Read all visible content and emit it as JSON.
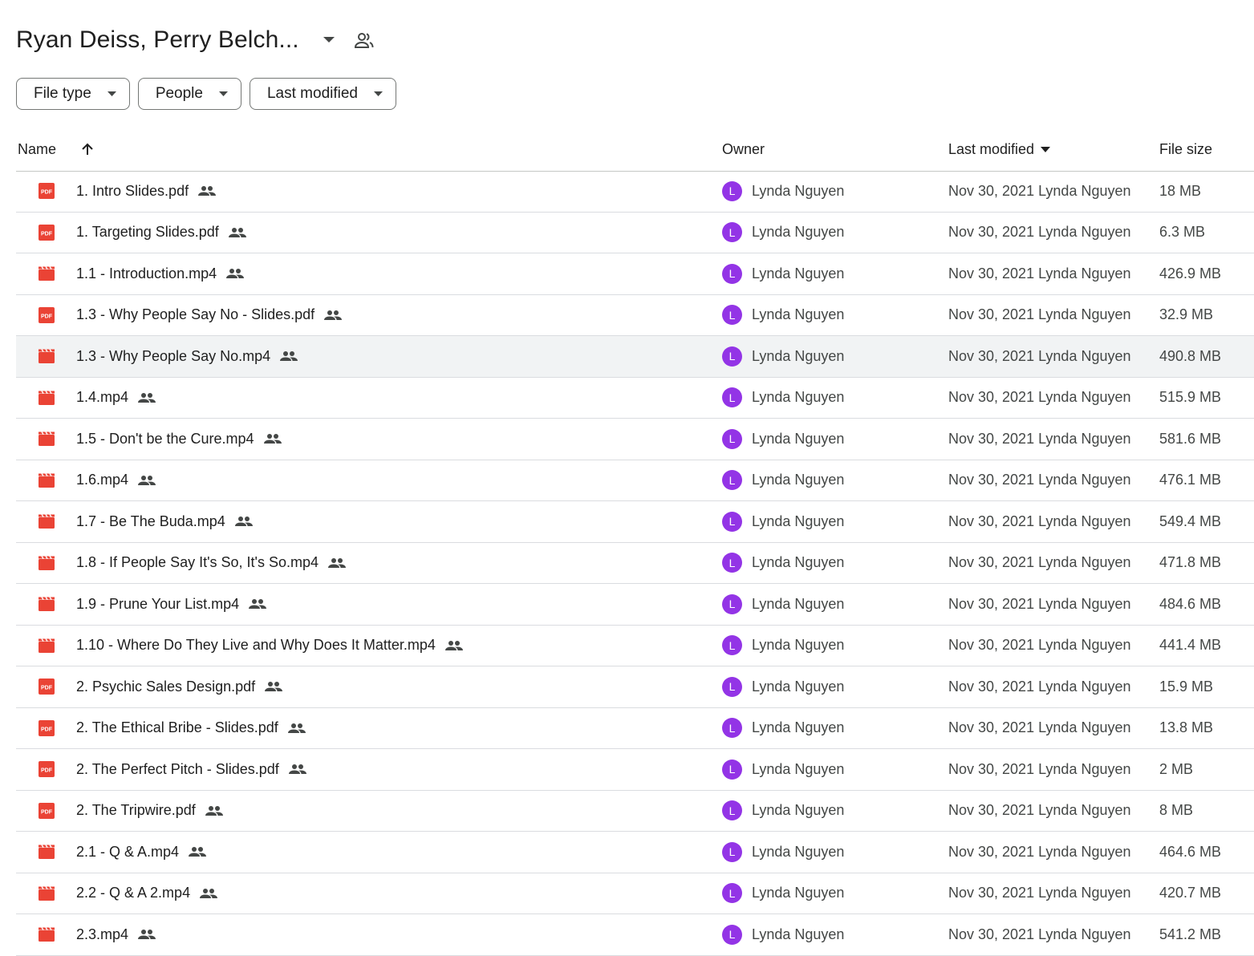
{
  "folder": {
    "title": "Ryan Deiss, Perry Belch..."
  },
  "filters": [
    {
      "label": "File type"
    },
    {
      "label": "People"
    },
    {
      "label": "Last modified"
    }
  ],
  "columns": {
    "name": "Name",
    "owner": "Owner",
    "modified": "Last modified",
    "size": "File size"
  },
  "files": [
    {
      "name": "1. Intro Slides.pdf",
      "type": "pdf",
      "owner": "Lynda Nguyen",
      "owner_initial": "L",
      "modified": "Nov 30, 2021 Lynda Nguyen",
      "size": "18 MB"
    },
    {
      "name": "1. Targeting Slides.pdf",
      "type": "pdf",
      "owner": "Lynda Nguyen",
      "owner_initial": "L",
      "modified": "Nov 30, 2021 Lynda Nguyen",
      "size": "6.3 MB"
    },
    {
      "name": "1.1 - Introduction.mp4",
      "type": "video",
      "owner": "Lynda Nguyen",
      "owner_initial": "L",
      "modified": "Nov 30, 2021 Lynda Nguyen",
      "size": "426.9 MB"
    },
    {
      "name": "1.3 - Why People Say No - Slides.pdf",
      "type": "pdf",
      "owner": "Lynda Nguyen",
      "owner_initial": "L",
      "modified": "Nov 30, 2021 Lynda Nguyen",
      "size": "32.9 MB"
    },
    {
      "name": "1.3 - Why People Say No.mp4",
      "type": "video",
      "owner": "Lynda Nguyen",
      "owner_initial": "L",
      "modified": "Nov 30, 2021 Lynda Nguyen",
      "size": "490.8 MB",
      "selected": true
    },
    {
      "name": "1.4.mp4",
      "type": "video",
      "owner": "Lynda Nguyen",
      "owner_initial": "L",
      "modified": "Nov 30, 2021 Lynda Nguyen",
      "size": "515.9 MB"
    },
    {
      "name": "1.5 - Don't be the Cure.mp4",
      "type": "video",
      "owner": "Lynda Nguyen",
      "owner_initial": "L",
      "modified": "Nov 30, 2021 Lynda Nguyen",
      "size": "581.6 MB"
    },
    {
      "name": "1.6.mp4",
      "type": "video",
      "owner": "Lynda Nguyen",
      "owner_initial": "L",
      "modified": "Nov 30, 2021 Lynda Nguyen",
      "size": "476.1 MB"
    },
    {
      "name": "1.7 - Be The Buda.mp4",
      "type": "video",
      "owner": "Lynda Nguyen",
      "owner_initial": "L",
      "modified": "Nov 30, 2021 Lynda Nguyen",
      "size": "549.4 MB"
    },
    {
      "name": "1.8 - If People Say It's So, It's So.mp4",
      "type": "video",
      "owner": "Lynda Nguyen",
      "owner_initial": "L",
      "modified": "Nov 30, 2021 Lynda Nguyen",
      "size": "471.8 MB"
    },
    {
      "name": "1.9 - Prune Your List.mp4",
      "type": "video",
      "owner": "Lynda Nguyen",
      "owner_initial": "L",
      "modified": "Nov 30, 2021 Lynda Nguyen",
      "size": "484.6 MB"
    },
    {
      "name": "1.10 - Where Do They Live and Why Does It Matter.mp4",
      "type": "video",
      "owner": "Lynda Nguyen",
      "owner_initial": "L",
      "modified": "Nov 30, 2021 Lynda Nguyen",
      "size": "441.4 MB"
    },
    {
      "name": "2. Psychic Sales Design.pdf",
      "type": "pdf",
      "owner": "Lynda Nguyen",
      "owner_initial": "L",
      "modified": "Nov 30, 2021 Lynda Nguyen",
      "size": "15.9 MB"
    },
    {
      "name": "2. The Ethical Bribe - Slides.pdf",
      "type": "pdf",
      "owner": "Lynda Nguyen",
      "owner_initial": "L",
      "modified": "Nov 30, 2021 Lynda Nguyen",
      "size": "13.8 MB"
    },
    {
      "name": "2. The Perfect Pitch - Slides.pdf",
      "type": "pdf",
      "owner": "Lynda Nguyen",
      "owner_initial": "L",
      "modified": "Nov 30, 2021 Lynda Nguyen",
      "size": "2 MB"
    },
    {
      "name": "2. The Tripwire.pdf",
      "type": "pdf",
      "owner": "Lynda Nguyen",
      "owner_initial": "L",
      "modified": "Nov 30, 2021 Lynda Nguyen",
      "size": "8 MB"
    },
    {
      "name": "2.1 - Q & A.mp4",
      "type": "video",
      "owner": "Lynda Nguyen",
      "owner_initial": "L",
      "modified": "Nov 30, 2021 Lynda Nguyen",
      "size": "464.6 MB"
    },
    {
      "name": "2.2 - Q & A 2.mp4",
      "type": "video",
      "owner": "Lynda Nguyen",
      "owner_initial": "L",
      "modified": "Nov 30, 2021 Lynda Nguyen",
      "size": "420.7 MB"
    },
    {
      "name": "2.3.mp4",
      "type": "video",
      "owner": "Lynda Nguyen",
      "owner_initial": "L",
      "modified": "Nov 30, 2021 Lynda Nguyen",
      "size": "541.2 MB"
    }
  ],
  "colors": {
    "pdf": "#ea4335",
    "video": "#ea4335",
    "avatar": "#9334e6",
    "selected_row": "#f1f3f4"
  },
  "icons": {
    "pdf": "pdf-icon",
    "video": "video-icon",
    "shared": "shared-people-icon",
    "sort": "arrow-up-icon",
    "caret": "caret-down-icon"
  }
}
